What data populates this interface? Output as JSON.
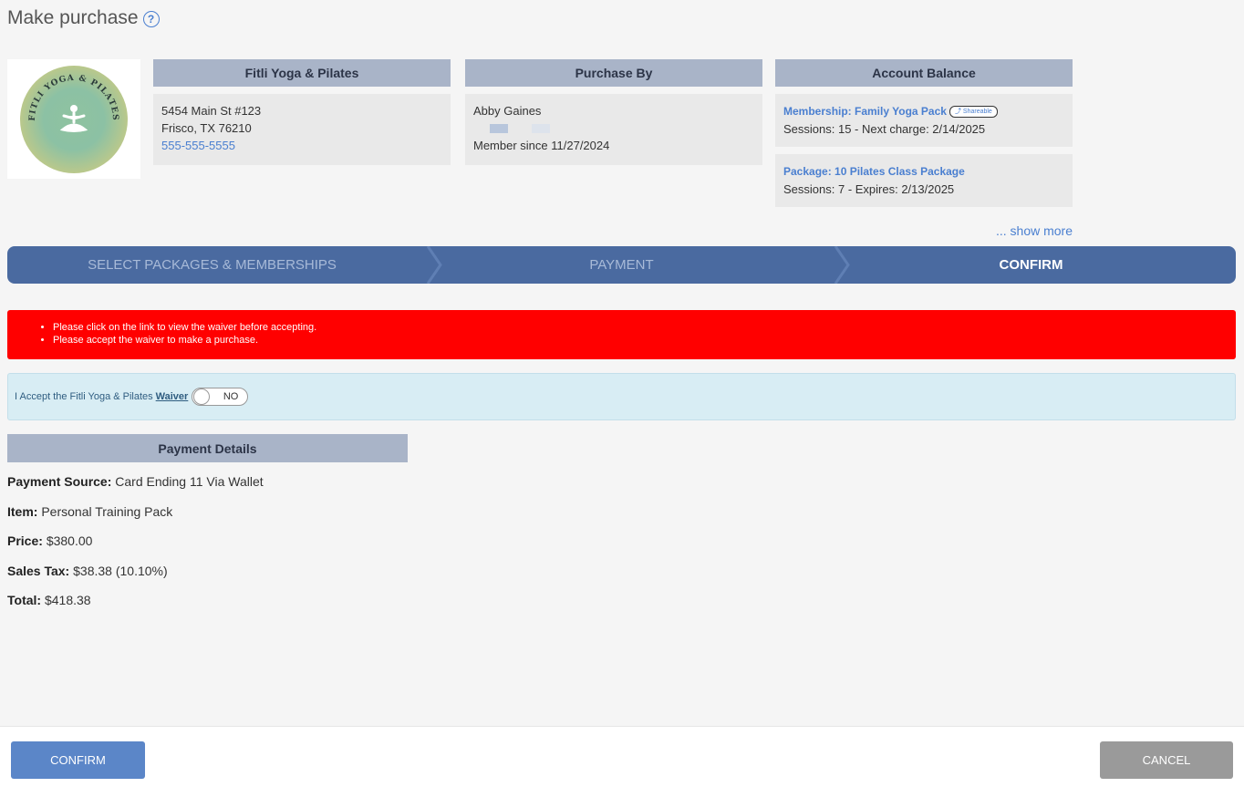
{
  "header": {
    "title": "Make purchase",
    "help_icon": "question-circle-icon"
  },
  "logo": {
    "text": "FITLI YOGA & PILATES"
  },
  "business": {
    "heading": "Fitli Yoga & Pilates",
    "address1": "5454 Main St #123",
    "address2": "Frisco, TX 76210",
    "phone": "555-555-5555"
  },
  "purchaser": {
    "heading": "Purchase By",
    "name": "Abby Gaines",
    "member_since": "Member since 11/27/2024"
  },
  "balance": {
    "heading": "Account Balance",
    "items": [
      {
        "title": "Membership: Family Yoga Pack",
        "badge": "Shareable",
        "detail": "Sessions: 15 - Next charge: 2/14/2025"
      },
      {
        "title": "Package: 10 Pilates Class Package",
        "detail": "Sessions: 7 - Expires: 2/13/2025"
      }
    ],
    "show_more": "... show more"
  },
  "steps": [
    {
      "label": "SELECT PACKAGES & MEMBERSHIPS",
      "active": false
    },
    {
      "label": "PAYMENT",
      "active": false
    },
    {
      "label": "CONFIRM",
      "active": true
    }
  ],
  "alert": {
    "color": "#ff0000",
    "messages": [
      "Please click on the link to view the waiver before accepting.",
      "Please accept the waiver to make a purchase."
    ]
  },
  "waiver": {
    "text": "I Accept the Fitli Yoga & Pilates",
    "link": "Waiver",
    "toggle_value": "NO"
  },
  "payment": {
    "heading": "Payment Details",
    "rows": [
      {
        "label": "Payment Source:",
        "value": "Card Ending 11 Via Wallet"
      },
      {
        "label": "Item:",
        "value": "Personal Training Pack"
      },
      {
        "label": "Price:",
        "value": "$380.00"
      },
      {
        "label": "Sales Tax:",
        "value": "$38.38 (10.10%)"
      },
      {
        "label": "Total:",
        "value": "$418.38"
      }
    ]
  },
  "footer": {
    "confirm_label": "CONFIRM",
    "cancel_label": "CANCEL"
  }
}
